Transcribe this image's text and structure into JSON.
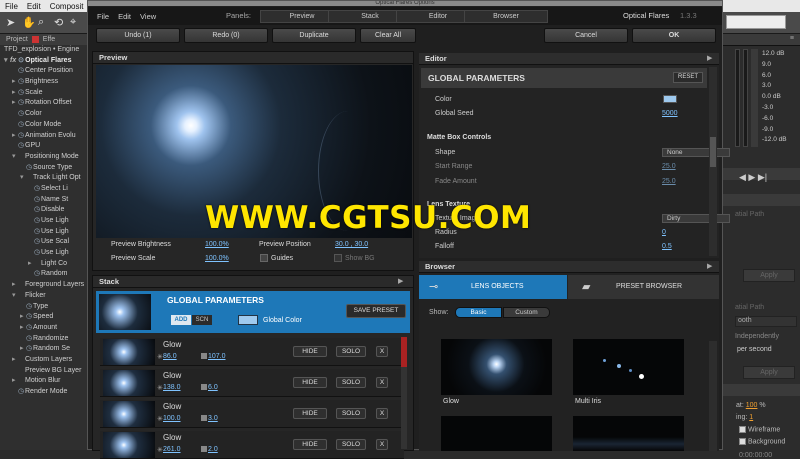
{
  "host": {
    "menu": [
      "File",
      "Edit",
      "Composit"
    ],
    "left_tabs": [
      "Project",
      "Effe"
    ],
    "layer_title": "TFD_explosion • Engine",
    "effect_name": "Optical Flares",
    "props": [
      {
        "d": 0,
        "t": "",
        "i": "◷",
        "l": "Center Position"
      },
      {
        "d": 0,
        "t": "▸",
        "i": "◷",
        "l": "Brightness"
      },
      {
        "d": 0,
        "t": "▸",
        "i": "◷",
        "l": "Scale"
      },
      {
        "d": 0,
        "t": "▸",
        "i": "◷",
        "l": "Rotation Offset"
      },
      {
        "d": 0,
        "t": "",
        "i": "◷",
        "l": "Color"
      },
      {
        "d": 0,
        "t": "",
        "i": "◷",
        "l": "Color Mode"
      },
      {
        "d": 0,
        "t": "▸",
        "i": "◷",
        "l": "Animation Evolu"
      },
      {
        "d": 0,
        "t": "",
        "i": "◷",
        "l": "GPU"
      },
      {
        "d": 0,
        "t": "▾",
        "i": "",
        "l": "Positioning Mode"
      },
      {
        "d": 1,
        "t": "",
        "i": "◷",
        "l": "Source Type"
      },
      {
        "d": 1,
        "t": "▾",
        "i": "",
        "l": "Track Light Opt"
      },
      {
        "d": 2,
        "t": "",
        "i": "◷",
        "l": "Select Li"
      },
      {
        "d": 2,
        "t": "",
        "i": "◷",
        "l": "Name St"
      },
      {
        "d": 2,
        "t": "",
        "i": "◷",
        "l": "Disable"
      },
      {
        "d": 2,
        "t": "",
        "i": "◷",
        "l": "Use Ligh"
      },
      {
        "d": 2,
        "t": "",
        "i": "◷",
        "l": "Use Ligh"
      },
      {
        "d": 2,
        "t": "",
        "i": "◷",
        "l": "Use Scal"
      },
      {
        "d": 2,
        "t": "",
        "i": "◷",
        "l": "Use Ligh"
      },
      {
        "d": 2,
        "t": "▸",
        "i": "",
        "l": "Light Co"
      },
      {
        "d": 2,
        "t": "",
        "i": "◷",
        "l": "Random"
      },
      {
        "d": 0,
        "t": "▸",
        "i": "",
        "l": "Foreground Layers"
      },
      {
        "d": 0,
        "t": "▾",
        "i": "",
        "l": "Flicker"
      },
      {
        "d": 1,
        "t": "",
        "i": "◷",
        "l": "Type"
      },
      {
        "d": 1,
        "t": "▸",
        "i": "◷",
        "l": "Speed"
      },
      {
        "d": 1,
        "t": "▸",
        "i": "◷",
        "l": "Amount"
      },
      {
        "d": 1,
        "t": "",
        "i": "◷",
        "l": "Randomize"
      },
      {
        "d": 1,
        "t": "▸",
        "i": "◷",
        "l": "Random Se"
      },
      {
        "d": 0,
        "t": "▸",
        "i": "",
        "l": "Custom Layers"
      },
      {
        "d": 0,
        "t": "",
        "i": "",
        "l": "Preview BG Layer"
      },
      {
        "d": 0,
        "t": "▸",
        "i": "",
        "l": "Motion Blur"
      },
      {
        "d": 0,
        "t": "",
        "i": "◷",
        "l": "Render Mode"
      }
    ],
    "right_meter": [
      "12.0 dB",
      "9.0",
      "6.0",
      "3.0",
      "0.0 dB",
      "-3.0",
      "-6.0",
      "-9.0",
      "-12.0 dB"
    ],
    "right_texts": {
      "apply1": "Apply",
      "spatial_path": "atial Path",
      "apply2": "Apply",
      "spatial_path2": "atial Path",
      "smooth": "ooth",
      "independently": "Independently",
      "per_second": "per second",
      "apply3": "Apply",
      "opacity_label": "at:",
      "opacity_val": "100",
      "opacity_unit": "%",
      "ing": "ing:",
      "ing_val": "1",
      "wireframe": "Wireframe",
      "background": "Background",
      "time": "0:00:00:00"
    }
  },
  "dialog": {
    "title": "Optical Flares Options",
    "menu": [
      "File",
      "Edit",
      "View"
    ],
    "panels_label": "Panels:",
    "panel_tabs": [
      "Preview",
      "Stack",
      "Editor",
      "Browser"
    ],
    "brand": "Optical Flares",
    "version": "1.3.3",
    "buttons": {
      "undo": "Undo (1)",
      "redo": "Redo (0)",
      "duplicate": "Duplicate",
      "clear": "Clear All",
      "cancel": "Cancel",
      "ok": "OK"
    }
  },
  "preview": {
    "title": "Preview",
    "brightness_label": "Preview Brightness",
    "brightness_value": "100.0%",
    "position_label": "Preview Position",
    "position_value": "30.0 , 30.0",
    "scale_label": "Preview Scale",
    "scale_value": "100.0%",
    "guides_label": "Guides",
    "showbg_label": "Show BG"
  },
  "stack": {
    "title": "Stack",
    "gp_title": "GLOBAL PARAMETERS",
    "add": "ADD",
    "scn": "SCN",
    "global_color": "Global Color",
    "save_preset": "SAVE PRESET",
    "hide": "HIDE",
    "solo": "SOLO",
    "x": "X",
    "rows": [
      {
        "name": "Glow",
        "a": "86.0",
        "b": "107.0"
      },
      {
        "name": "Glow",
        "a": "138.0",
        "b": "6.0"
      },
      {
        "name": "Glow",
        "a": "100.0",
        "b": "3.0"
      },
      {
        "name": "Glow",
        "a": "261.0",
        "b": "2.0"
      }
    ]
  },
  "editor": {
    "title": "Editor",
    "section": "GLOBAL PARAMETERS",
    "reset": "RESET",
    "color_label": "Color",
    "seed_label": "Global Seed",
    "seed_value": "5000",
    "mb_title": "Matte Box Controls",
    "shape_label": "Shape",
    "shape_value": "None",
    "start_label": "Start Range",
    "start_value": "25.0",
    "fade_label": "Fade Amount",
    "fade_value": "25.0",
    "lt_title": "Lens Texture",
    "ti_label": "Texture Image",
    "ti_value": "Dirty",
    "radius_label": "Radius",
    "radius_value": "0",
    "falloff_label": "Falloff",
    "falloff_value": "0.5",
    "color_hex": "#9ec9ee"
  },
  "browser": {
    "title": "Browser",
    "lens_tab": "LENS OBJECTS",
    "preset_tab": "PRESET BROWSER",
    "show_label": "Show:",
    "basic": "Basic",
    "custom": "Custom",
    "items": [
      "Glow",
      "Multi Iris"
    ]
  },
  "watermark": "WWW.CGTSU.COM",
  "colors": {
    "accent": "#1e78b8",
    "link": "#7fc3ff",
    "watermark": "#ffe600"
  }
}
